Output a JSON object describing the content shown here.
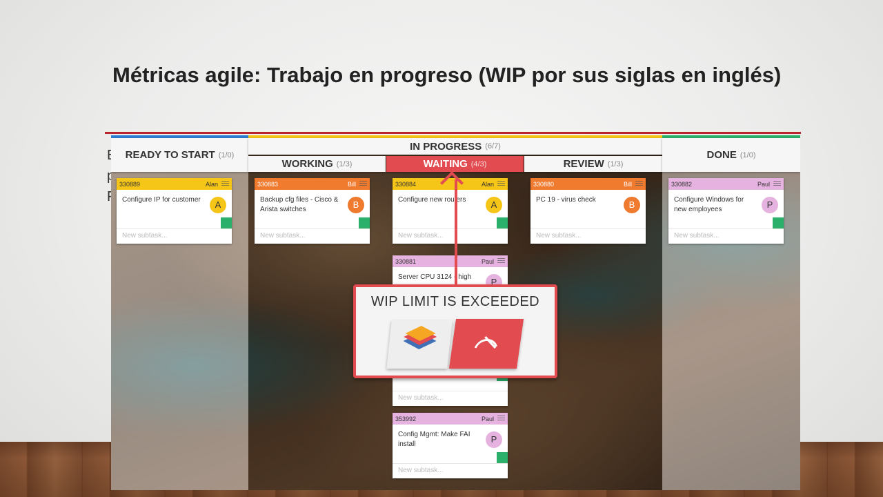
{
  "slide": {
    "title": "Métricas agile: Trabajo en progreso (WIP por sus siglas en inglés)",
    "partial_letters": [
      "E",
      "p",
      "F"
    ]
  },
  "board": {
    "columns": {
      "ready": {
        "label": "READY TO START",
        "count": "(1/0)"
      },
      "in_progress": {
        "label": "IN PROGRESS",
        "count": "(6/7)"
      },
      "working": {
        "label": "WORKING",
        "count": "(1/3)"
      },
      "waiting": {
        "label": "WAITING",
        "count": "(4/3)"
      },
      "review": {
        "label": "REVIEW",
        "count": "(1/3)"
      },
      "done": {
        "label": "DONE",
        "count": "(1/0)"
      }
    },
    "colors": {
      "yellow": "#f5c518",
      "orange": "#f07a2e",
      "pink": "#e6b3e0",
      "red": "#e24b4f",
      "green": "#2bb06b"
    },
    "cards": [
      {
        "id": "330889",
        "owner": "Alan",
        "text": "Configure IP for customer",
        "avatar": "A",
        "avatar_color": "#f5c518",
        "header_color": "#f5c518",
        "subtask": "New subtask..."
      },
      {
        "id": "330883",
        "owner": "Bill",
        "text": "Backup cfg files - Cisco & Arista switches",
        "avatar": "B",
        "avatar_color": "#f07a2e",
        "header_color": "#f07a2e",
        "subtask": "New subtask..."
      },
      {
        "id": "330884",
        "owner": "Alan",
        "text": "Configure new routers",
        "avatar": "A",
        "avatar_color": "#f5c518",
        "header_color": "#f5c518",
        "subtask": "New subtask..."
      },
      {
        "id": "330880",
        "owner": "Bill",
        "text": "PC 19 - virus check",
        "avatar": "B",
        "avatar_color": "#f07a2e",
        "header_color": "#f07a2e",
        "subtask": "New subtask..."
      },
      {
        "id": "330882",
        "owner": "Paul",
        "text": "Configure Windows for new employees",
        "avatar": "P",
        "avatar_color": "#e6b3e0",
        "header_color": "#e6b3e0",
        "subtask": "New subtask..."
      },
      {
        "id": "330881",
        "owner": "Paul",
        "text": "Server CPU 3124 - high",
        "avatar": "P",
        "avatar_color": "#e6b3e0",
        "header_color": "#e6b3e0",
        "subtask": "New subtask..."
      },
      {
        "id": "353992",
        "owner": "Paul",
        "text": "Config Mgmt: Make FAI install",
        "avatar": "P",
        "avatar_color": "#e6b3e0",
        "header_color": "#e6b3e0",
        "subtask": "New subtask..."
      }
    ],
    "hidden_card_subtask": "New subtask...",
    "alert": {
      "title": "WIP LIMIT IS EXCEEDED",
      "left_icon": "layers-logo-icon",
      "right_icon": "gauge-icon"
    }
  }
}
